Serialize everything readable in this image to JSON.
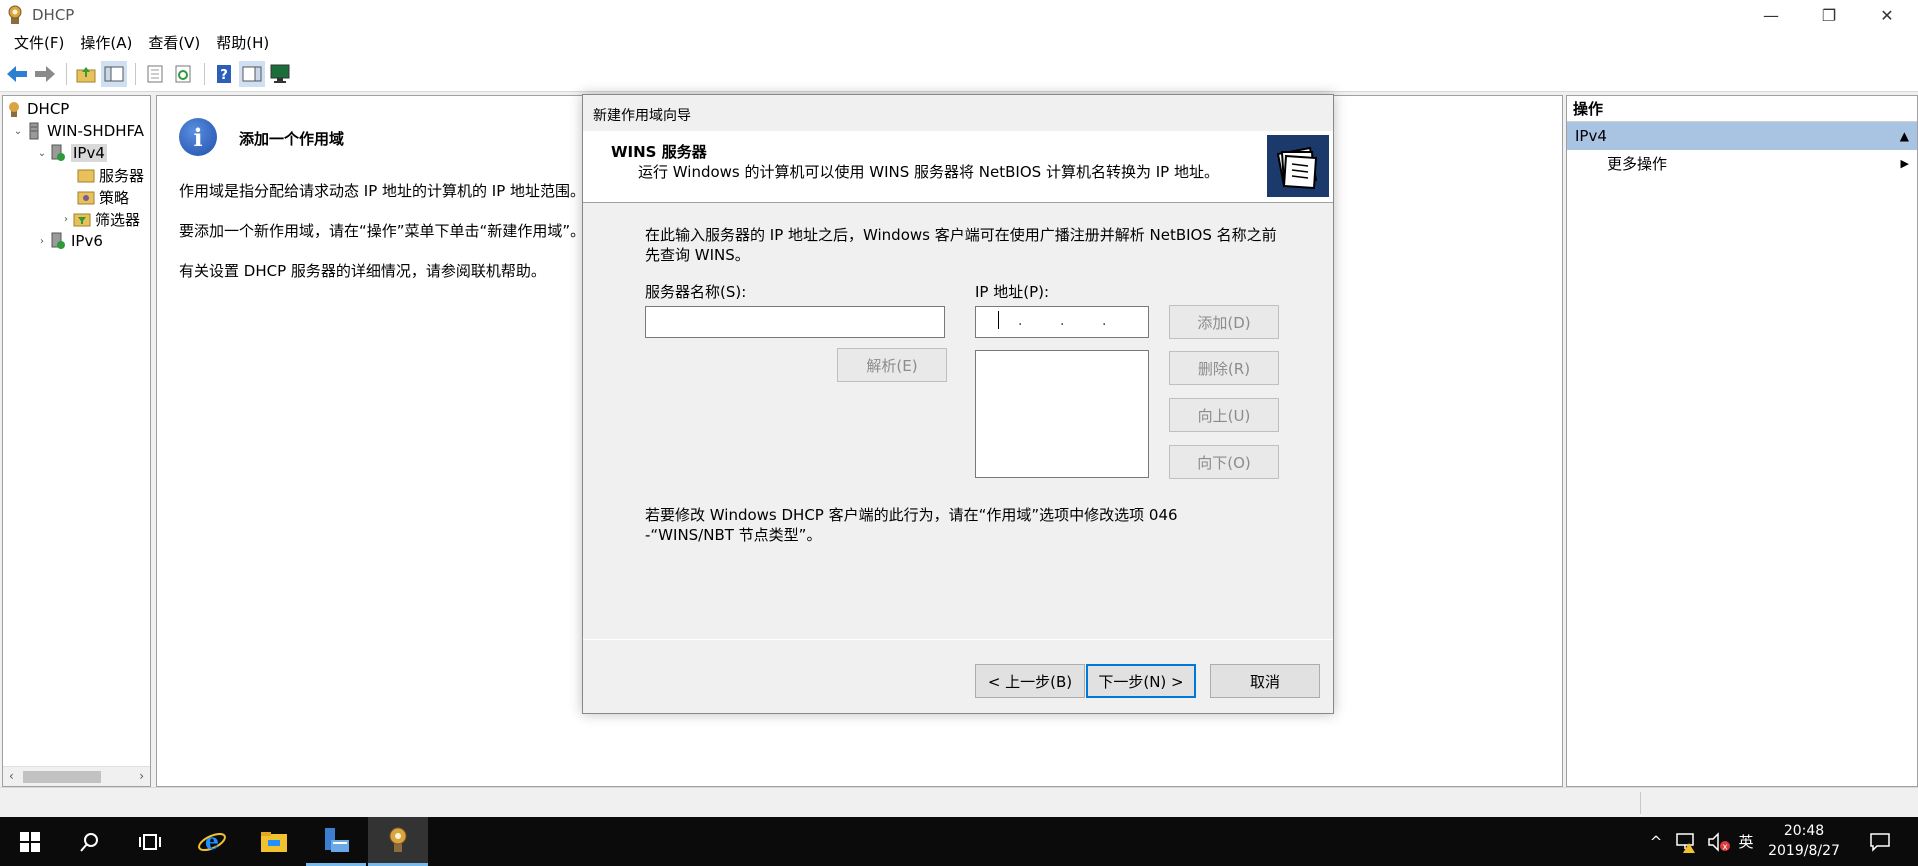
{
  "window": {
    "title": "DHCP",
    "minimize_glyph": "—",
    "restore_glyph": "❐",
    "close_glyph": "✕"
  },
  "menu": [
    "文件(F)",
    "操作(A)",
    "查看(V)",
    "帮助(H)"
  ],
  "toolbar": {
    "icons": [
      "back-icon",
      "forward-icon",
      "up-folder-icon",
      "show-hide-tree-icon",
      "properties-icon",
      "refresh-icon",
      "help-icon",
      "action-pane-icon",
      "monitor-icon"
    ]
  },
  "tree": {
    "items": [
      {
        "label": "DHCP",
        "icon": "dhcp-icon"
      },
      {
        "label": "WIN-SHDHFA",
        "icon": "server-icon"
      },
      {
        "label": "IPv4",
        "icon": "ipv4-icon"
      },
      {
        "label": "服务器",
        "icon": "folder-icon"
      },
      {
        "label": "策略",
        "icon": "policy-icon"
      },
      {
        "label": "筛选器",
        "icon": "filter-icon"
      },
      {
        "label": "IPv6",
        "icon": "ipv6-icon"
      }
    ]
  },
  "center": {
    "title": "添加一个作用域",
    "lines": [
      "作用域是指分配给请求动态 IP 地址的计算机的 IP 地址范围。你",
      "要添加一个新作用域，请在“操作”菜单下单击“新建作用域”。",
      "有关设置 DHCP 服务器的详细情况，请参阅联机帮助。"
    ]
  },
  "actions": {
    "header": "操作",
    "section": "IPv4",
    "more": "更多操作"
  },
  "dialog": {
    "title": "新建作用域向导",
    "heading": "WINS 服务器",
    "subheading": "运行 Windows 的计算机可以使用 WINS 服务器将 NetBIOS 计算机名转换为 IP 地址。",
    "description": "在此输入服务器的 IP 地址之后，Windows 客户端可在使用广播注册并解析 NetBIOS 名称之前先查询 WINS。",
    "server_name_label": "服务器名称(S):",
    "server_name_value": "",
    "ip_label": "IP 地址(P):",
    "ip_dot": ".",
    "resolve_button": "解析(E)",
    "add_button": "添加(D)",
    "remove_button": "删除(R)",
    "up_button": "向上(U)",
    "down_button": "向下(O)",
    "note": "若要修改 Windows DHCP 客户端的此行为，请在“作用域”选项中修改选项 046 -“WINS/NBT 节点类型”。",
    "back_button": "< 上一步(B)",
    "next_button": "下一步(N) >",
    "cancel_button": "取消"
  },
  "taskbar": {
    "apps": [
      "start-icon",
      "search-icon",
      "task-view-icon",
      "ie-icon",
      "file-explorer-icon",
      "server-manager-icon",
      "dhcp-app-icon"
    ],
    "tray": {
      "chevron": "^",
      "ime": "英",
      "time": "20:48",
      "date": "2019/8/27"
    }
  },
  "colors": {
    "accent": "#0078d7",
    "selection": "#a9c4e2",
    "taskbar": "#0b0b0b"
  }
}
